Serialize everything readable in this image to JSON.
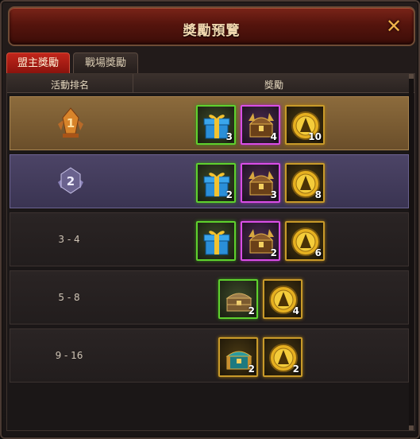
{
  "window": {
    "title": "獎勵預覽",
    "close_glyph": "✕"
  },
  "tabs": [
    {
      "label": "盟主獎勵",
      "active": true
    },
    {
      "label": "戰場獎勵",
      "active": false
    }
  ],
  "table": {
    "header_rank": "活動排名",
    "header_reward": "獎勵",
    "rows": [
      {
        "rank": "1",
        "rank_display": "badge",
        "style": "gold",
        "items": [
          {
            "icon": "gift-box-icon",
            "rarity": "green",
            "count": "3"
          },
          {
            "icon": "treasure-chest-icon",
            "rarity": "purple",
            "count": "4"
          },
          {
            "icon": "gold-coin-icon",
            "rarity": "orange",
            "count": "10"
          }
        ]
      },
      {
        "rank": "2",
        "rank_display": "badge",
        "style": "silver",
        "items": [
          {
            "icon": "gift-box-icon",
            "rarity": "green",
            "count": "2"
          },
          {
            "icon": "treasure-chest-icon",
            "rarity": "purple",
            "count": "3"
          },
          {
            "icon": "gold-coin-icon",
            "rarity": "orange",
            "count": "8"
          }
        ]
      },
      {
        "rank": "3 - 4",
        "rank_display": "text",
        "style": "dark",
        "items": [
          {
            "icon": "gift-box-icon",
            "rarity": "green",
            "count": ""
          },
          {
            "icon": "treasure-chest-icon",
            "rarity": "purple",
            "count": "2"
          },
          {
            "icon": "gold-coin-icon",
            "rarity": "orange",
            "count": "6"
          }
        ]
      },
      {
        "rank": "5 - 8",
        "rank_display": "text",
        "style": "dark",
        "items": [
          {
            "icon": "wooden-chest-icon",
            "rarity": "green",
            "count": "2"
          },
          {
            "icon": "gold-coin-icon",
            "rarity": "orange",
            "count": "4"
          }
        ]
      },
      {
        "rank": "9 - 16",
        "rank_display": "text",
        "style": "dark",
        "items": [
          {
            "icon": "teal-chest-icon",
            "rarity": "orange",
            "count": "2"
          },
          {
            "icon": "gold-coin-icon",
            "rarity": "orange",
            "count": "2"
          }
        ]
      }
    ]
  },
  "colors": {
    "title_bar": "#6a1a10",
    "tab_active": "#b8201a",
    "row_gold": "#7a5c32",
    "row_silver": "#433c5c",
    "rarity_green": "#5fd12e",
    "rarity_purple": "#d94ee6",
    "rarity_orange": "#c89a2a"
  }
}
